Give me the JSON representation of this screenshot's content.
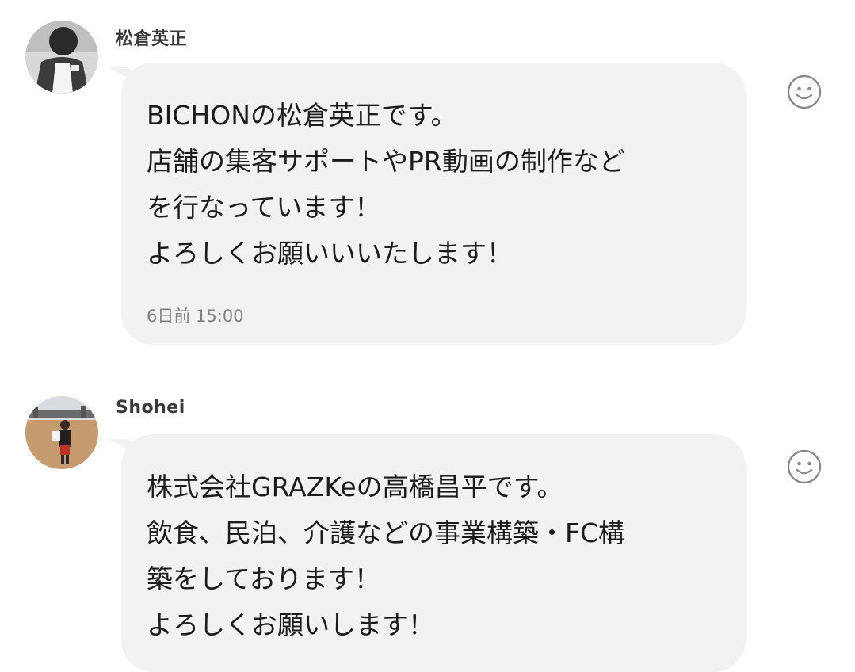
{
  "messages": [
    {
      "sender": "松倉英正",
      "lines": [
        "BICHONの松倉英正です。",
        "店舗の集客サポートやPR動画の制作など",
        "を行なっています！",
        "よろしくお願いいいたします！"
      ],
      "time": "6日前 15:00",
      "reaction_icon": "smiley-icon"
    },
    {
      "sender": "Shohei",
      "lines": [
        "株式会社GRAZKeの高橋昌平です。",
        "飲食、民泊、介護などの事業構築・FC構",
        "築をしております！",
        "よろしくお願いします！"
      ],
      "reaction_icon": "smiley-icon"
    }
  ],
  "colors": {
    "bubble": "#f2f2f2",
    "sender": "#3a3a3a",
    "time": "#808080",
    "icon": "#8a8a8a"
  }
}
